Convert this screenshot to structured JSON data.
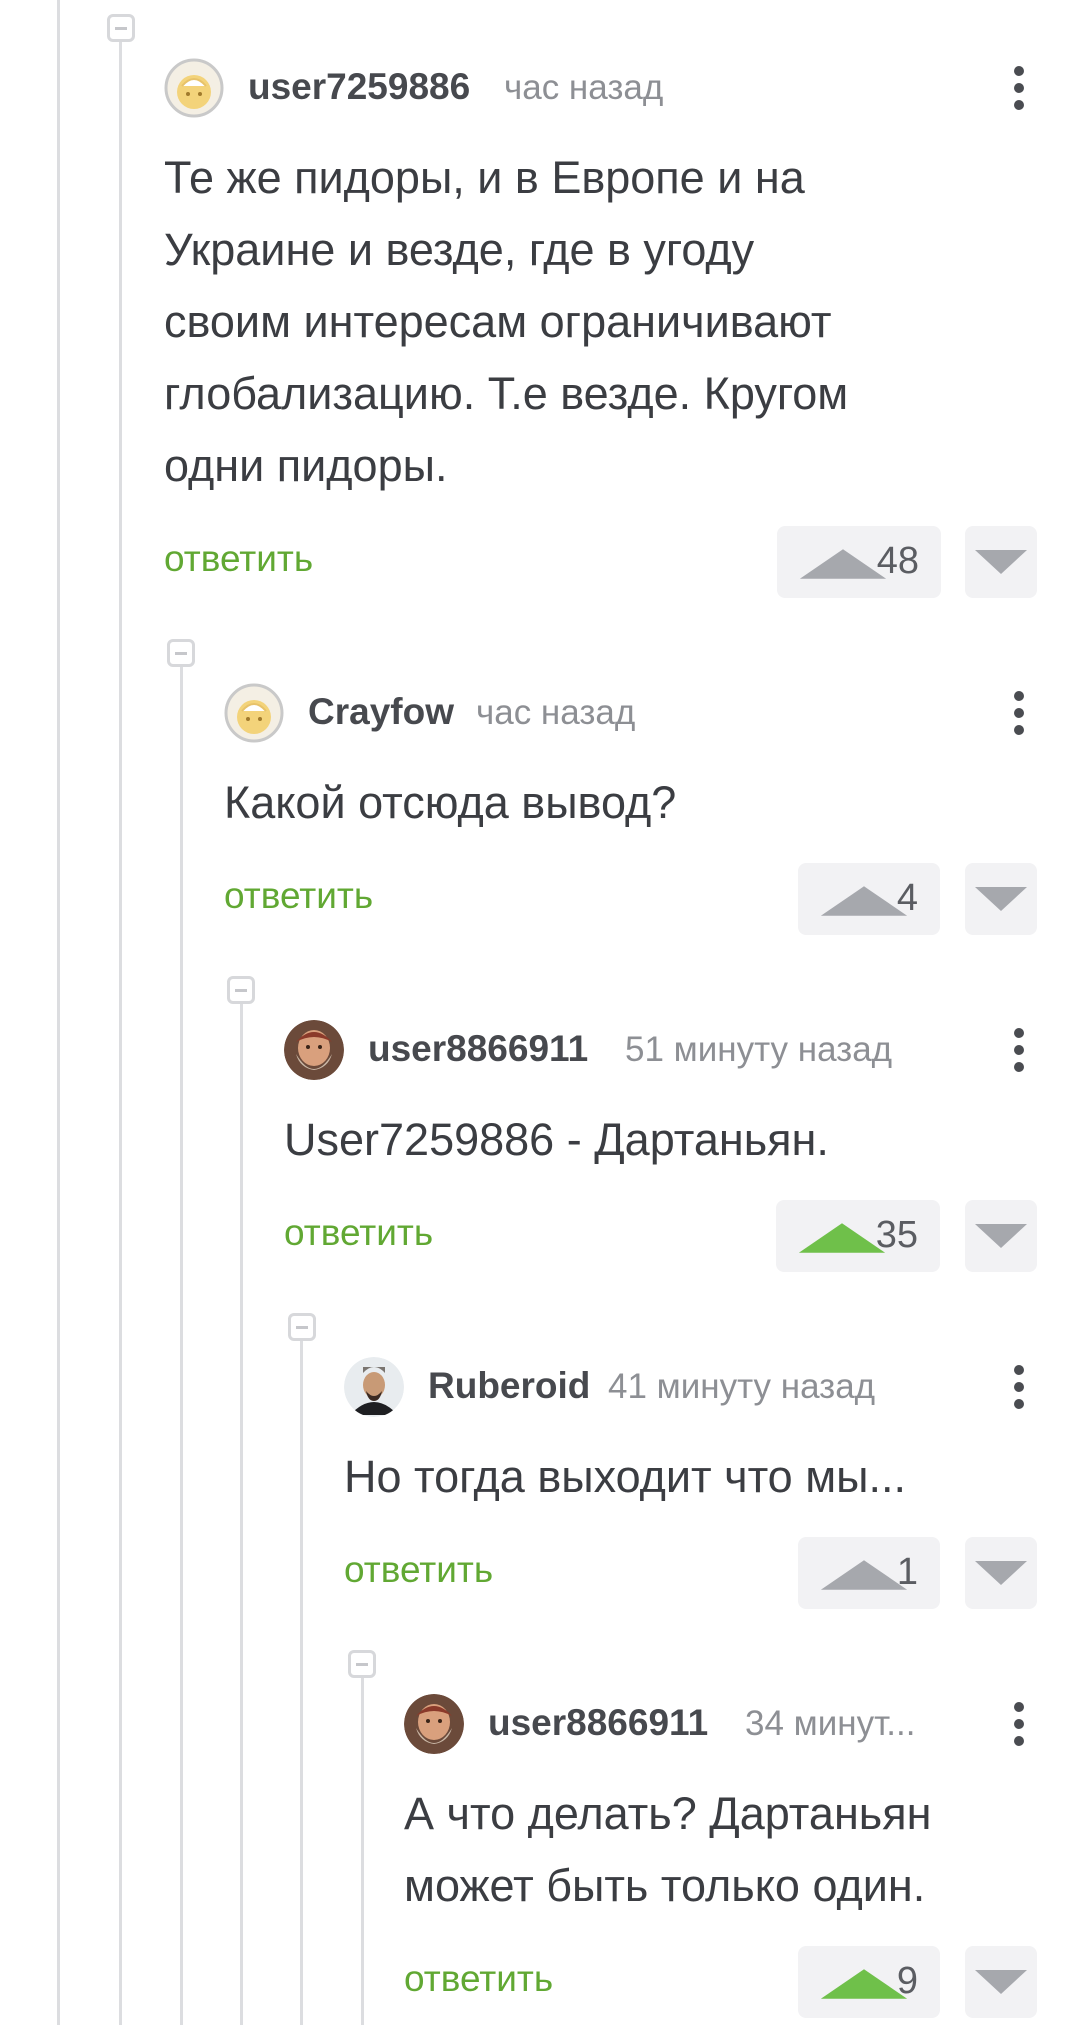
{
  "comments": [
    {
      "username": "user7259886",
      "time": "час назад",
      "avatar_icon": "default-avatar-icon",
      "text": "Те же пидоры, и в Европе и на\nУкраине и везде, где в угоду\nсвоим интересам ограничивают\nглобализацию. Т.е везде. Кругом\nодни пидоры.",
      "reply_label": "ответить",
      "score": "48",
      "upvoted": false
    },
    {
      "username": "Crayfow",
      "time": "час назад",
      "avatar_icon": "default-avatar-icon",
      "text": "Какой отсюда вывод?",
      "reply_label": "ответить",
      "score": "4",
      "upvoted": false
    },
    {
      "username": "user8866911",
      "time": "51 минуту назад",
      "avatar_icon": "bearded-man-avatar",
      "text": "User7259886 - Дартаньян.",
      "reply_label": "ответить",
      "score": "35",
      "upvoted": true
    },
    {
      "username": "Ruberoid",
      "time": "41 минуту назад",
      "avatar_icon": "portrait-avatar",
      "text": "Но тогда выходит что мы...",
      "reply_label": "ответить",
      "score": "1",
      "upvoted": false
    },
    {
      "username": "user8866911",
      "time": "34 минут...",
      "avatar_icon": "bearded-man-avatar",
      "text": "А что делать? Дартаньян\nможет быть только один.",
      "reply_label": "ответить",
      "score": "9",
      "upvoted": true
    }
  ],
  "colors": {
    "reply_green": "#61a833",
    "upvote_active": "#6fc04a",
    "vote_inactive": "#a6a8ad",
    "thread_line": "#dcdde0"
  }
}
